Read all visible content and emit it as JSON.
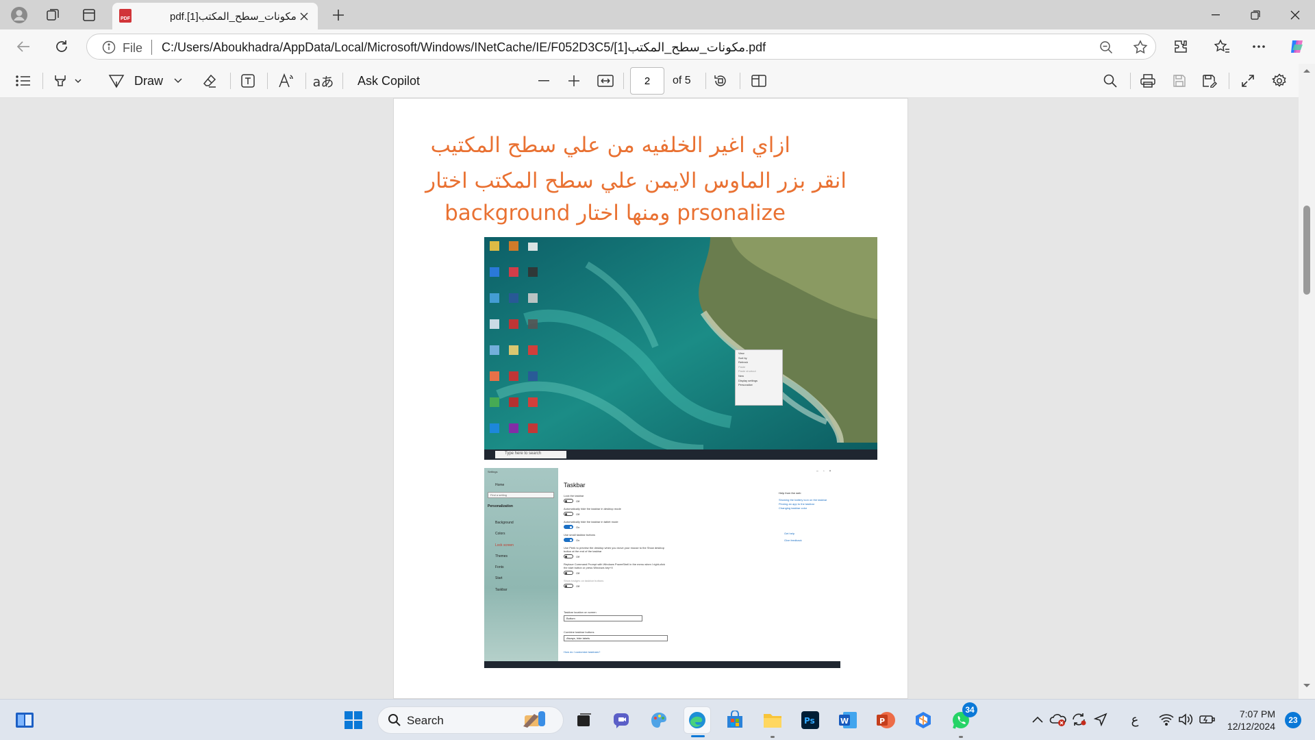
{
  "browser": {
    "tab_title": "pdf.[1]مكونات_سطح_المكتب",
    "new_tab_icon": "plus-icon",
    "address": {
      "file_label": "File",
      "url": "C:/Users/Aboukhadra/AppData/Local/Microsoft/Windows/INetCache/IE/F052D3C5/[1]مكونات_سطح_المكتب.pdf"
    }
  },
  "pdf_toolbar": {
    "draw_label": "Draw",
    "ask_copilot_label": "Ask Copilot",
    "page_current": "2",
    "page_total": "of 5"
  },
  "document": {
    "heading_color": "#e97132",
    "line1": "ازاي اغير الخلفيه من علي سطح المكتيب",
    "line2": "انقر بزر الماوس الايمن علي سطح المكتب اختار",
    "line3": "prsonalize ومنها اختار background",
    "screenshot1": {
      "context_menu": [
        "View",
        "Sort by",
        "Refresh",
        "Paste",
        "Paste shortcut",
        "New",
        "Display settings",
        "Personalize"
      ],
      "taskbar_search": "Type here to search"
    },
    "screenshot2": {
      "sidebar_title": "Settings",
      "sidebar_home": "Home",
      "sidebar_find": "Find a setting",
      "sidebar_section": "Personalization",
      "sidebar_items": [
        "Background",
        "Colors",
        "Lock screen",
        "Themes",
        "Fonts",
        "Start",
        "Taskbar"
      ],
      "heading": "Taskbar",
      "settings": [
        {
          "label": "Lock the taskbar",
          "state": "Off",
          "on": false
        },
        {
          "label": "Automatically hide the taskbar in desktop mode",
          "state": "Off",
          "on": false
        },
        {
          "label": "Automatically hide the taskbar in tablet mode",
          "state": "On",
          "on": true
        },
        {
          "label": "Use small taskbar buttons",
          "state": "On",
          "on": true
        },
        {
          "label": "Use Peek to preview the desktop when you move your mouse to the Show desktop button at the end of the taskbar",
          "state": "Off",
          "on": false
        },
        {
          "label": "Replace Command Prompt with Windows PowerShell in the menu when I right-click the start button or press Windows key+X",
          "state": "Off",
          "on": false
        },
        {
          "label": "Show badges on taskbar buttons",
          "state": "Off",
          "on": false
        }
      ],
      "location_label": "Taskbar location on screen",
      "location_value": "Bottom",
      "combine_label": "Combine taskbar buttons",
      "combine_value": "Always, hide labels",
      "help_link": "How do I customize taskbars?",
      "web_help_title": "Help from the web",
      "web_links": [
        "Showing the battery icon on the taskbar",
        "Pinning an app to the taskbar",
        "Changing taskbar color"
      ],
      "get_help": "Get help",
      "give_feedback": "Give feedback"
    }
  },
  "taskbar": {
    "search_label": "Search",
    "whatsapp_badge": "34",
    "ime_label": "ع",
    "time": "7:07 PM",
    "date": "12/12/2024",
    "notifications": "23"
  }
}
